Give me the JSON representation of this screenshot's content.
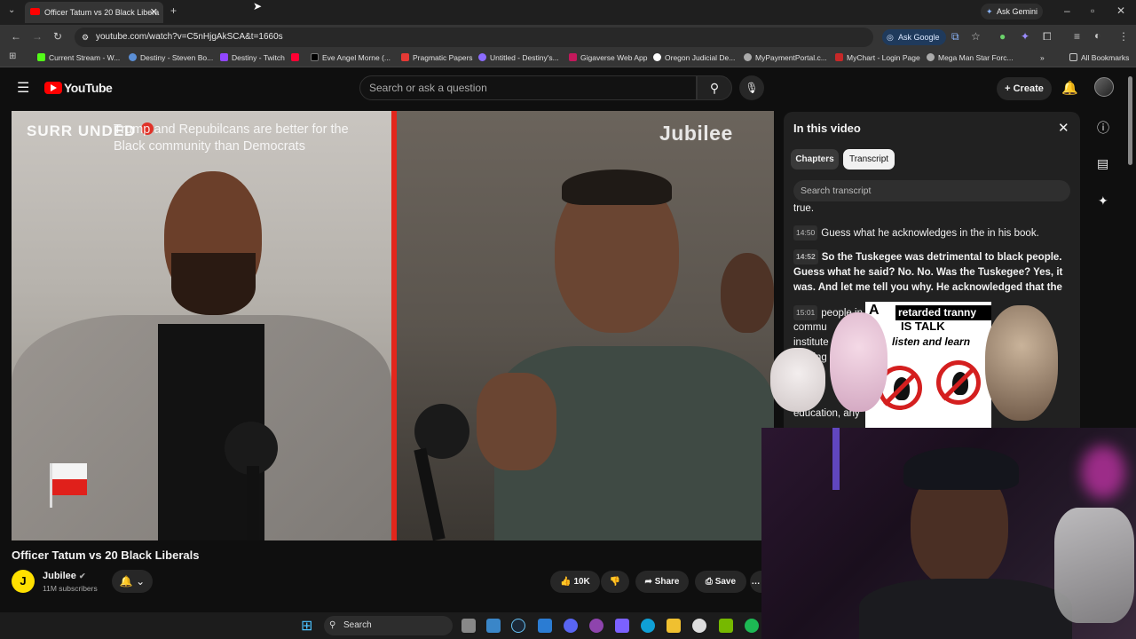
{
  "browser": {
    "tab_title": "Officer Tatum vs 20 Black Libera",
    "url": "youtube.com/watch?v=C5nHjgAkSCA&t=1660s",
    "ask_gemini": "Ask Gemini",
    "ask_google": "Ask Google",
    "bookmarks": [
      "Current Stream - W...",
      "Destiny - Steven Bo...",
      "Destiny - Twitch",
      "Eve Angel Morne (...",
      "Pragmatic Papers",
      "Untitled - Destiny's...",
      "Gigaverse Web App",
      "Oregon Judicial De...",
      "MyPaymentPortal.c...",
      "MyChart - Login Page",
      "Mega Man Star Forc..."
    ],
    "all_bookmarks": "All Bookmarks"
  },
  "youtube": {
    "logo_text": "YouTube",
    "search_placeholder": "Search or ask a question",
    "create_label": "Create"
  },
  "video": {
    "overlay_brand": "SURR UNDED",
    "overlay_headline": "Trump and Repubilcans are better for the Black community than Democrats",
    "watermark": "Jubilee",
    "title": "Officer Tatum vs 20 Black Liberals",
    "channel_initial": "J",
    "channel_name": "Jubilee",
    "subscribers": "11M subscribers",
    "likes": "10K",
    "share_label": "Share",
    "save_label": "Save"
  },
  "side_panel": {
    "title": "In this video",
    "chip_chapters": "Chapters",
    "chip_transcript": "Transcript",
    "search_placeholder": "Search transcript",
    "lines": [
      {
        "time": "",
        "text": "true."
      },
      {
        "time": "14:50",
        "text": "Guess what he acknowledges in the in his book."
      },
      {
        "time": "14:52",
        "text": "So the Tuskegee was detrimental to black people. Guess what he said? No. No. Was the Tuskegee? Yes, it was. And let me tell you why. He acknowledged that the"
      },
      {
        "time": "15:01",
        "text": "people in"
      },
      {
        "time": "",
        "text": "commu"
      },
      {
        "time": "",
        "text": "institute"
      },
      {
        "time": "",
        "text": "nothing t"
      },
      {
        "time": "",
        "text": "education, any"
      }
    ]
  },
  "meme": {
    "letter": "A",
    "band": "retarded tranny",
    "line2": "IS TALK",
    "line3": "listen and learn"
  },
  "taskbar": {
    "search_label": "Search"
  },
  "colors": {
    "yt_red": "#ff0000",
    "surround_red": "#e3261c",
    "jubilee_yellow": "#ffe000"
  }
}
